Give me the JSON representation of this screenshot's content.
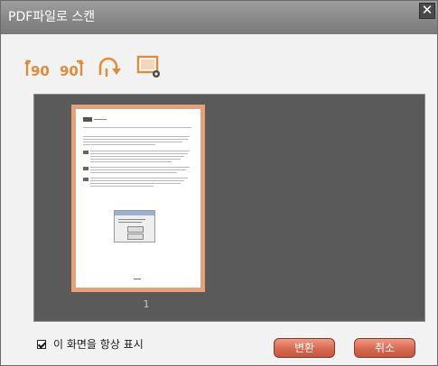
{
  "window": {
    "title": "PDF파일로 스캔",
    "close_label": "✕"
  },
  "toolbar": {
    "items": [
      {
        "name": "rotate-left-90-icon",
        "label": "90"
      },
      {
        "name": "rotate-right-90-icon",
        "label": "90"
      },
      {
        "name": "rotate-180-icon"
      },
      {
        "name": "crop-settings-icon"
      }
    ]
  },
  "viewer": {
    "page_number": "1"
  },
  "footer": {
    "always_show_label": "이 화면을 항상 표시",
    "convert_label": "변환",
    "cancel_label": "취소"
  },
  "colors": {
    "accent": "#d8684f",
    "toolbar_icon": "#e08a3c",
    "viewer_bg": "#5a5a5a",
    "thumb_border": "#e5a07c"
  }
}
